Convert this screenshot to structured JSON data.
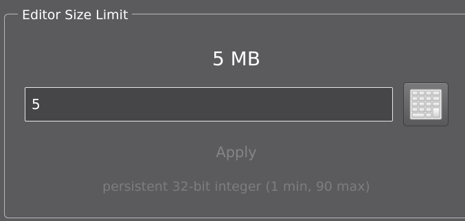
{
  "group": {
    "title": "Editor Size Limit"
  },
  "value_display": "5 MB",
  "input": {
    "value": "5"
  },
  "keypad": {
    "icon": "keypad-icon"
  },
  "apply_label": "Apply",
  "hint": "persistent 32-bit integer (1 min, 90 max)",
  "colors": {
    "background": "#5b5b5d",
    "input_background": "#464648",
    "disabled_text": "#858587"
  }
}
